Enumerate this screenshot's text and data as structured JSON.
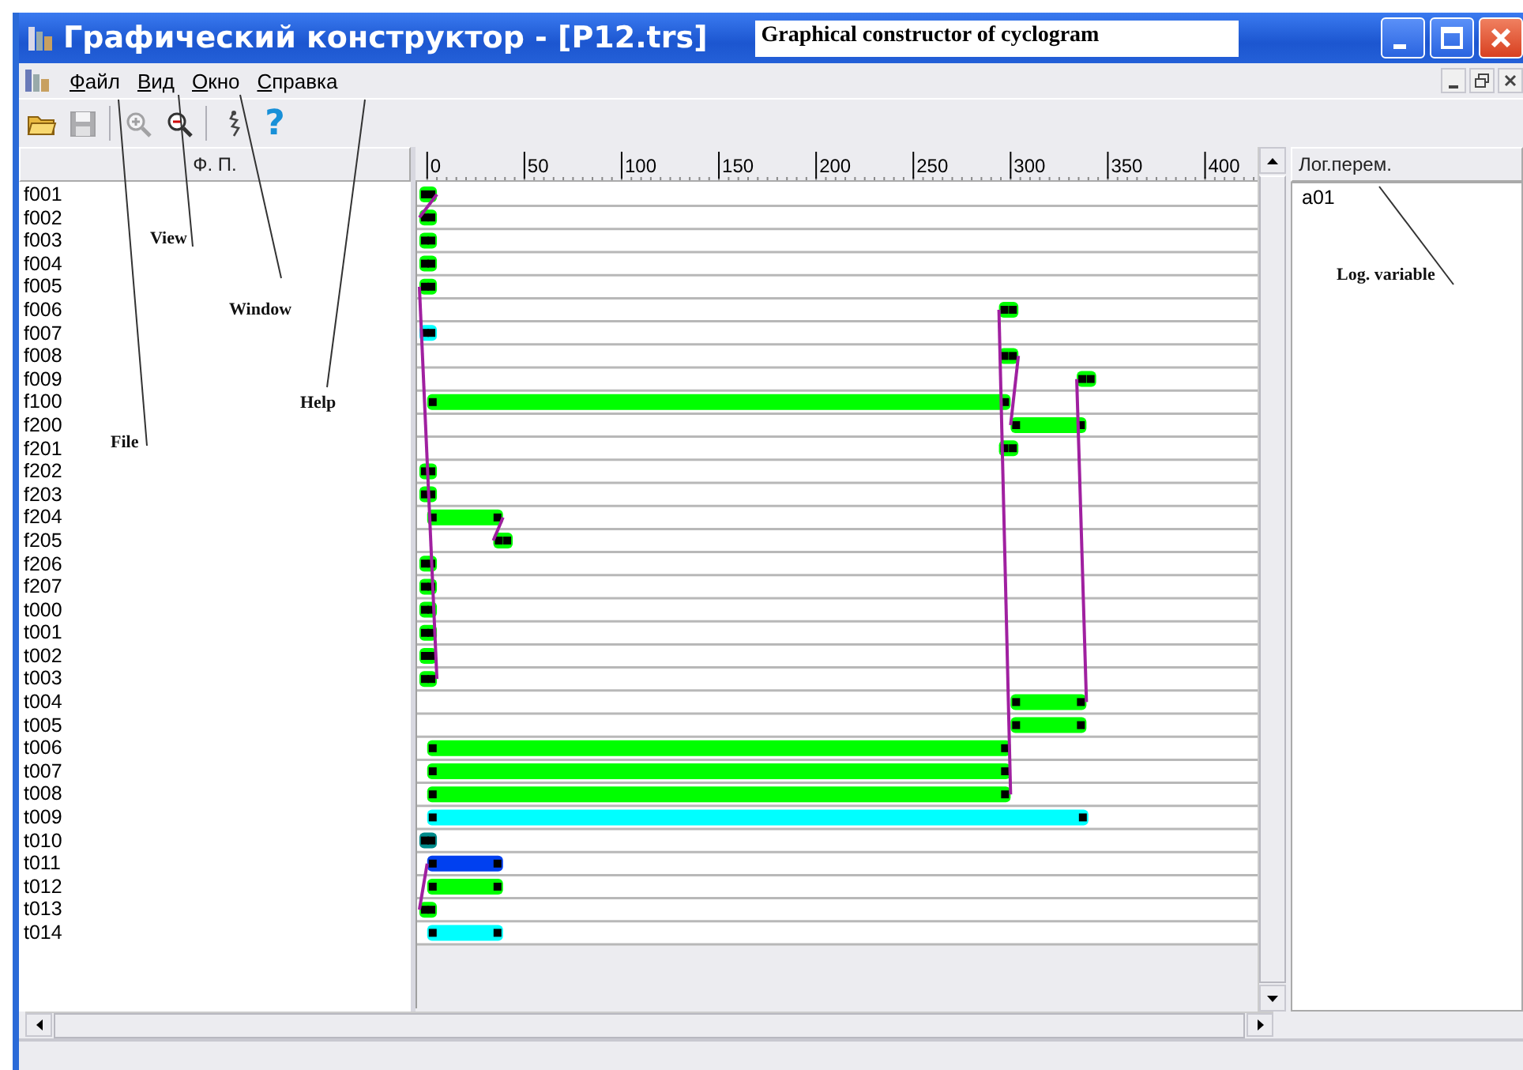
{
  "window": {
    "title": "Графический конструктор - [P12.trs]",
    "note": "Graphical constructor of cyclogram"
  },
  "menu": [
    "Файл",
    "Вид",
    "Окно",
    "Справка"
  ],
  "toolbar": [
    {
      "kind": "open",
      "disabled": false
    },
    {
      "kind": "save",
      "disabled": true
    },
    {
      "kind": "zoom-in",
      "disabled": true
    },
    {
      "kind": "zoom-out",
      "disabled": false
    },
    {
      "kind": "tool",
      "disabled": false
    },
    {
      "kind": "help",
      "label": "?",
      "disabled": false
    }
  ],
  "signals_header": "Ф. П.",
  "ruler": [
    "0",
    "50",
    "100",
    "150",
    "200",
    "250",
    "300",
    "350",
    "400"
  ],
  "signals": [
    {
      "name": "f001",
      "color": "#00ff00"
    },
    {
      "name": "f002",
      "color": "#00ff00"
    },
    {
      "name": "f003",
      "color": "#00ff00"
    },
    {
      "name": "f004",
      "color": "#00ff00"
    },
    {
      "name": "f005",
      "color": "#00ff00"
    },
    {
      "name": "f006",
      "color": "#00ff00"
    },
    {
      "name": "f007",
      "color": "#00ffff"
    },
    {
      "name": "f008",
      "color": "#00ff00"
    },
    {
      "name": "f009",
      "color": "#00ff00"
    },
    {
      "name": "f100",
      "color": "#00ff00"
    },
    {
      "name": "f200",
      "color": "#00ff00"
    },
    {
      "name": "f201",
      "color": "#00ff00"
    },
    {
      "name": "f202",
      "color": "#00ff00"
    },
    {
      "name": "f203",
      "color": "#00ff00"
    },
    {
      "name": "f204",
      "color": "#00ff00"
    },
    {
      "name": "f205",
      "color": "#00ff00"
    },
    {
      "name": "f206",
      "color": "#00ff00"
    },
    {
      "name": "f207",
      "color": "#00ff00"
    },
    {
      "name": "t000",
      "color": "#00ff00"
    },
    {
      "name": "t001",
      "color": "#00ff00"
    },
    {
      "name": "t002",
      "color": "#00ff00"
    },
    {
      "name": "t003",
      "color": "#00ff00"
    },
    {
      "name": "t004",
      "color": "#00ff00"
    },
    {
      "name": "t005",
      "color": "#00ff00"
    },
    {
      "name": "t006",
      "color": "#00ff00"
    },
    {
      "name": "t007",
      "color": "#00ff00"
    },
    {
      "name": "t008",
      "color": "#00ff00"
    },
    {
      "name": "t009",
      "color": "#00ffff"
    },
    {
      "name": "t010",
      "color": "#008b8b"
    },
    {
      "name": "t011",
      "color": "#0040f0"
    },
    {
      "name": "t012",
      "color": "#00ff00"
    },
    {
      "name": "t013",
      "color": "#00ff00"
    },
    {
      "name": "t014",
      "color": "#00ffff"
    }
  ],
  "variables": {
    "header": "Лог.перем.",
    "items": [
      "a01"
    ]
  },
  "callouts": [
    {
      "text": "View"
    },
    {
      "text": "Window"
    },
    {
      "text": "Help"
    },
    {
      "text": "File"
    },
    {
      "text": "Log. variable"
    }
  ]
}
